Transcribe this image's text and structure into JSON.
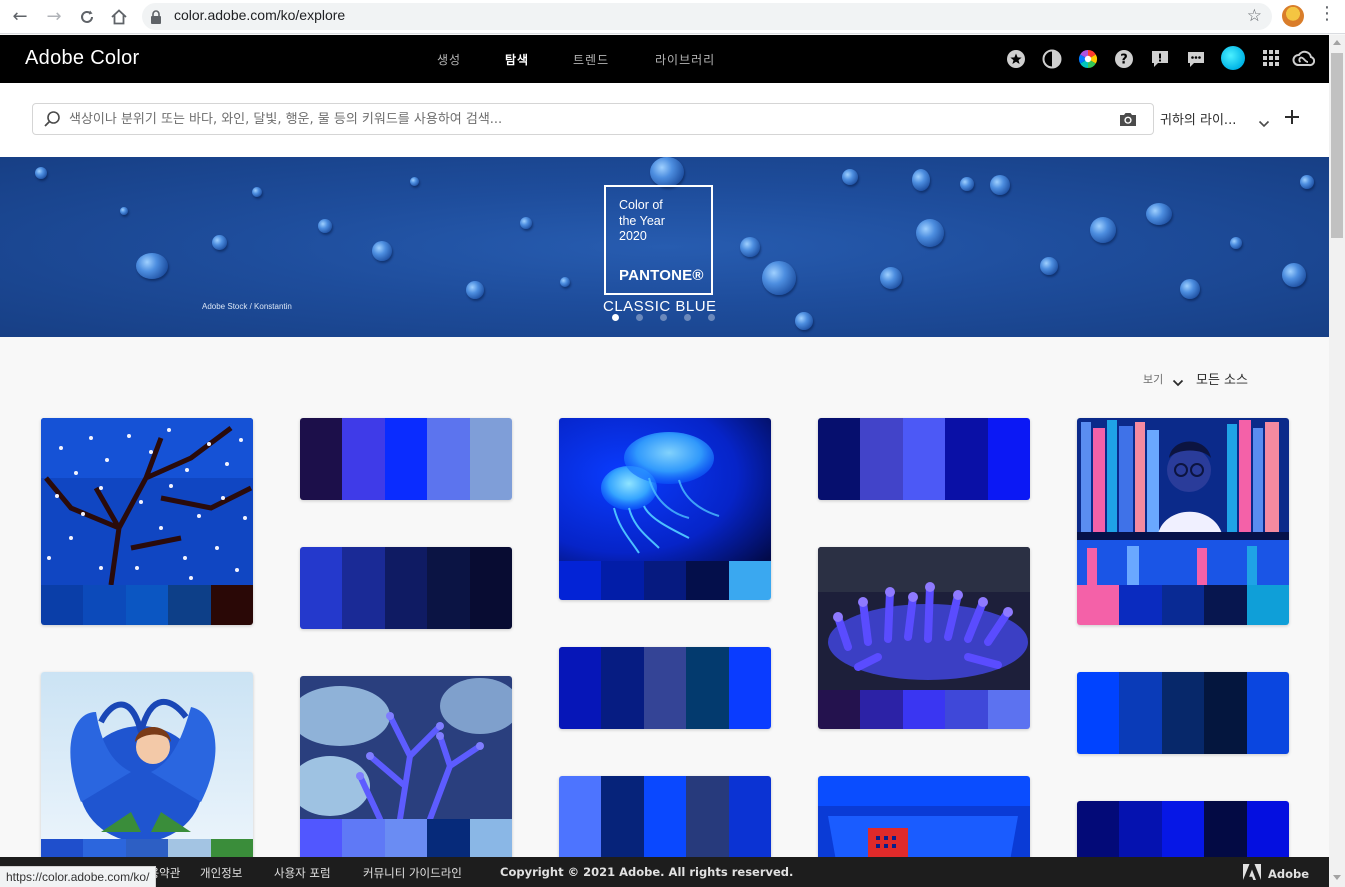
{
  "browser": {
    "url": "color.adobe.com/ko/explore",
    "status_url": "https://color.adobe.com/ko/"
  },
  "header": {
    "logo": "Adobe Color",
    "tabs": [
      {
        "label": "생성",
        "active": false
      },
      {
        "label": "탐색",
        "active": true
      },
      {
        "label": "트렌드",
        "active": false
      },
      {
        "label": "라이브러리",
        "active": false
      }
    ],
    "icons": [
      "star-icon",
      "contrast-icon",
      "color-wheel-icon",
      "help-icon",
      "feedback-icon",
      "chat-icon",
      "avatar",
      "apps-grid-icon",
      "creative-cloud-icon"
    ]
  },
  "search": {
    "placeholder": "색상이나 분위기 또는 바다, 와인, 달빛, 행운, 물 등의 키워드를 사용하여 검색...",
    "value": "",
    "library_label": "귀하의 라이..."
  },
  "banner": {
    "title_lines": [
      "Color of",
      "the Year",
      "2020"
    ],
    "brand": "PANTONE®",
    "color_name": "CLASSIC BLUE",
    "credit": "Adobe Stock / Konstantin",
    "slide_count": 5,
    "active_slide": 0,
    "bg_color": "#1f4e9e"
  },
  "view": {
    "label": "보기",
    "value": "모든 소스"
  },
  "cards": [
    {
      "name": "card-blossom-tree",
      "image": "blossom-tree",
      "swatches": [
        "#0a3ea8",
        "#0c4aba",
        "#0b56c2",
        "#0d3f88",
        "#2a0806"
      ]
    },
    {
      "name": "card-palette-1",
      "image": null,
      "swatches": [
        "#1c0f4a",
        "#3f3be8",
        "#0a2cff",
        "#5c74ee",
        "#7f9ed8"
      ]
    },
    {
      "name": "card-jellyfish",
      "image": "jellyfish",
      "swatches": [
        "#0323d6",
        "#021da8",
        "#061a80",
        "#040f4b",
        "#3aa8f0"
      ]
    },
    {
      "name": "card-palette-2",
      "image": null,
      "swatches": [
        "#060f6e",
        "#4244c9",
        "#4c59f6",
        "#0a10a6",
        "#0b18f5"
      ]
    },
    {
      "name": "card-library-girl",
      "image": "library-girl",
      "swatches": [
        "#f461a8",
        "#0a2bbf",
        "#092a94",
        "#07164f",
        "#0f9fd8"
      ]
    },
    {
      "name": "card-palette-3",
      "image": null,
      "swatches": [
        "#2439cc",
        "#1a2a96",
        "#0f1b63",
        "#0b1444",
        "#080c32"
      ]
    },
    {
      "name": "card-coral-purple",
      "image": "coral-purple",
      "swatches": [
        "#24124e",
        "#2c22a6",
        "#3a36f2",
        "#3f48d9",
        "#5c72f0"
      ]
    },
    {
      "name": "card-flower-girl",
      "image": "flower-girl",
      "swatches": [
        "#1f4fcc",
        "#2c66dd",
        "#2d5fc4",
        "#a3c4e3",
        "#3a8d3a"
      ]
    },
    {
      "name": "card-palette-4",
      "image": null,
      "swatches": [
        "#0616b8",
        "#061c82",
        "#344496",
        "#033a6e",
        "#0a3cff"
      ]
    },
    {
      "name": "card-palette-5",
      "image": null,
      "swatches": [
        "#0043ff",
        "#0a3bb8",
        "#07286a",
        "#04163e",
        "#0a46e0"
      ]
    },
    {
      "name": "card-coral-blue",
      "image": "coral-blue",
      "swatches": [
        "#5157ff",
        "#5f79f6",
        "#6a8cf3",
        "#062a7a",
        "#8ab7e6"
      ]
    },
    {
      "name": "card-palette-6",
      "image": null,
      "swatches": [
        "#4d74ff",
        "#06237a",
        "#0a48ff",
        "#273a7c",
        "#0b33d3"
      ]
    },
    {
      "name": "card-blue-device",
      "image": "blue-device",
      "swatches": []
    },
    {
      "name": "card-palette-7",
      "image": null,
      "swatches": [
        "#030a78",
        "#0512b0",
        "#0617e6",
        "#030a44",
        "#040fe0"
      ]
    }
  ],
  "footer": {
    "links": [
      "이용약관",
      "개인정보",
      "사용자 포럼",
      "커뮤니티 가이드라인"
    ],
    "copyright": "Copyright © 2021 Adobe. All rights reserved.",
    "brand": "Adobe"
  }
}
